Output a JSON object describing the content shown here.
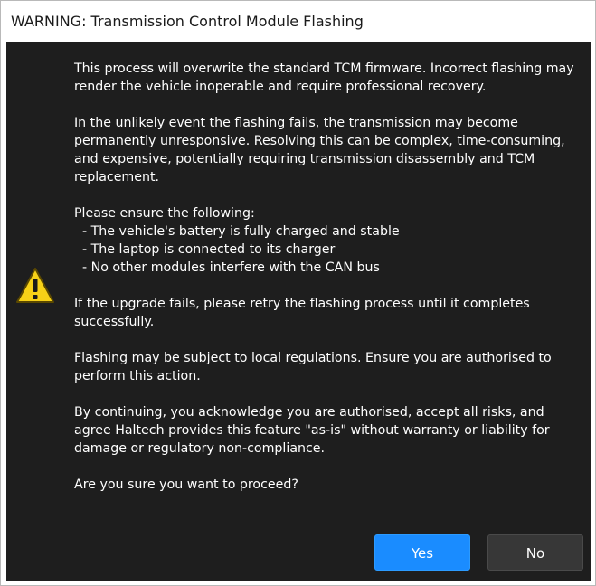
{
  "window": {
    "title": "WARNING: Transmission Control Module Flashing"
  },
  "icon": {
    "name": "warning-triangle-icon",
    "color": "#f7d117"
  },
  "message": {
    "p1": "This process will overwrite the standard TCM firmware. Incorrect flashing may render the vehicle inoperable and require professional recovery.",
    "p2": "In the unlikely event the flashing fails, the transmission may become permanently unresponsive. Resolving this can be complex, time-consuming, and expensive, potentially requiring transmission disassembly and TCM replacement.",
    "list_intro": "Please ensure the following:",
    "list_items": [
      "- The vehicle's battery is fully charged and stable",
      "- The laptop is connected to its charger",
      "- No other modules interfere with the CAN bus"
    ],
    "p3": "If the upgrade fails, please retry the flashing process until it completes successfully.",
    "p4": "Flashing may be subject to local regulations. Ensure you are authorised to perform this action.",
    "p5": "By continuing, you acknowledge you are authorised, accept all risks, and agree Haltech provides this feature \"as-is\" without warranty or liability for damage or regulatory non-compliance.",
    "question": "Are you sure you want to proceed?"
  },
  "buttons": {
    "yes_label": "Yes",
    "no_label": "No",
    "yes_color": "#1a8cff",
    "no_color": "#373737"
  }
}
